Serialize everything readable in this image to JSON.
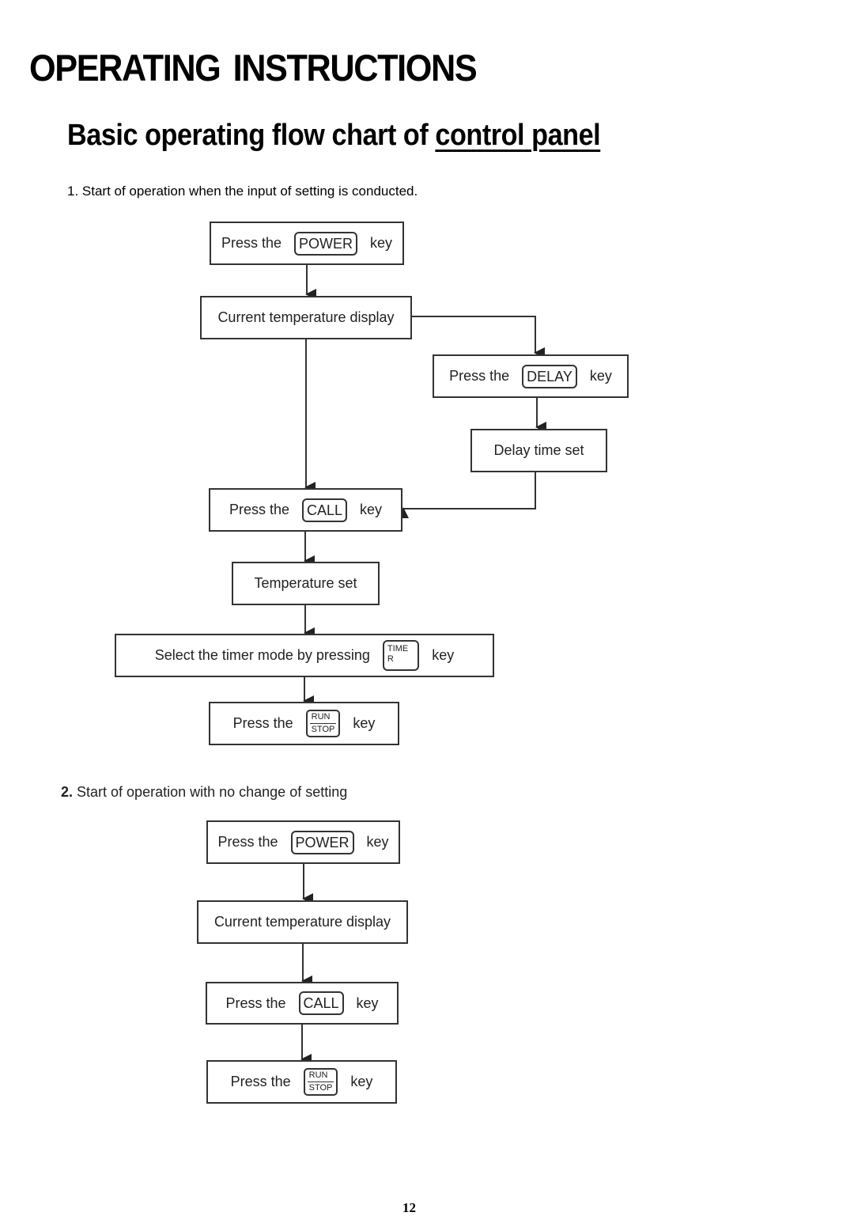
{
  "header": {
    "title": "OPERATING INSTRUCTIONS",
    "subtitle_prefix": "Basic operating flow chart of ",
    "subtitle_underlined": "control panel"
  },
  "section1": {
    "label": "1. Start of operation when the input of setting is conducted.",
    "nodes": {
      "power": {
        "prefix": "Press the",
        "key": "POWER",
        "suffix": "key"
      },
      "current_temp": {
        "text": "Current temperature display"
      },
      "delay": {
        "prefix": "Press the",
        "key": "DELAY",
        "suffix": "key"
      },
      "delay_time": {
        "text": "Delay time set"
      },
      "call": {
        "prefix": "Press the",
        "key": "CALL",
        "suffix": "key"
      },
      "temp_set": {
        "text": "Temperature set"
      },
      "timer_mode": {
        "prefix": "Select the timer mode by pressing",
        "key_top": "TIME",
        "key_bottom": "R",
        "suffix": "key"
      },
      "run_stop": {
        "prefix": "Press the",
        "key_top": "RUN",
        "key_bottom": "STOP",
        "suffix": "key"
      }
    }
  },
  "section2": {
    "label_number": "2.",
    "label_text": " Start of operation with no change of setting",
    "nodes": {
      "power": {
        "prefix": "Press the",
        "key": "POWER",
        "suffix": "key"
      },
      "current_temp": {
        "text": "Current temperature display"
      },
      "call": {
        "prefix": "Press the",
        "key": "CALL",
        "suffix": "key"
      },
      "run_stop": {
        "prefix": "Press the",
        "key_top": "RUN",
        "key_bottom": "STOP",
        "suffix": "key"
      }
    }
  },
  "footer": {
    "page_number": "12"
  }
}
